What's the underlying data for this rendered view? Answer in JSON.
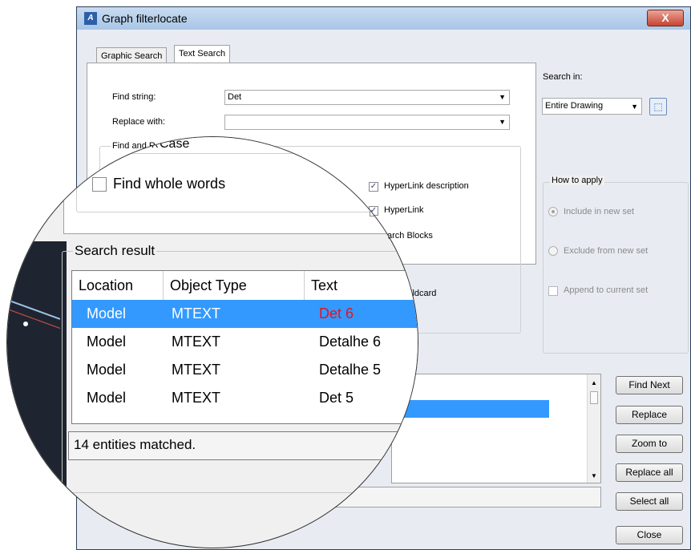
{
  "window": {
    "title": "Graph filterlocate",
    "close_label": "X"
  },
  "tabs": [
    {
      "label": "Graphic Search"
    },
    {
      "label": "Text Search"
    }
  ],
  "find": {
    "label": "Find string:",
    "value": "Det"
  },
  "replace": {
    "label": "Replace with:",
    "value": ""
  },
  "find_group": {
    "title": "Find and Replace options",
    "title_visible": "Find and R"
  },
  "magnified_title_fragment": "Case",
  "options": {
    "find_whole_words": {
      "label": "Find whole words",
      "checked": false
    },
    "hyperlink_description": {
      "label": "HyperLink description",
      "checked": true
    },
    "hyperlink": {
      "label": "HyperLink",
      "checked": true
    },
    "search_blocks": {
      "label": "Search Blocks",
      "visible_text": "arch Blocks"
    },
    "wildcard": {
      "label": "Use wildcard",
      "visible_text": "ildcard"
    }
  },
  "search_in": {
    "label": "Search in:",
    "value": "Entire Drawing"
  },
  "how_to_apply": {
    "title": "How to apply",
    "include": "Include in new set",
    "exclude": "Exclude from new set",
    "append": "Append to current set"
  },
  "result": {
    "title": "Search result",
    "columns": [
      "Location",
      "Object Type",
      "Text"
    ],
    "rows": [
      {
        "location": "Model",
        "type": "MTEXT",
        "text": "Det 6",
        "selected": true
      },
      {
        "location": "Model",
        "type": "MTEXT",
        "text": "Detalhe 6",
        "selected": false
      },
      {
        "location": "Model",
        "type": "MTEXT",
        "text": "Detalhe 5",
        "selected": false
      },
      {
        "location": "Model",
        "type": "MTEXT",
        "text": "Det 5",
        "selected": false
      }
    ],
    "status": "14 entities matched.",
    "status_small": "14 enti"
  },
  "buttons": {
    "find_next": "Find Next",
    "replace": "Replace",
    "zoom_to": "Zoom to",
    "replace_all": "Replace all",
    "select_all": "Select all",
    "close": "Close"
  },
  "colors": {
    "selection": "#3399ff",
    "match_text": "#e8121b",
    "title_gradient_top": "#c8dcf0"
  }
}
